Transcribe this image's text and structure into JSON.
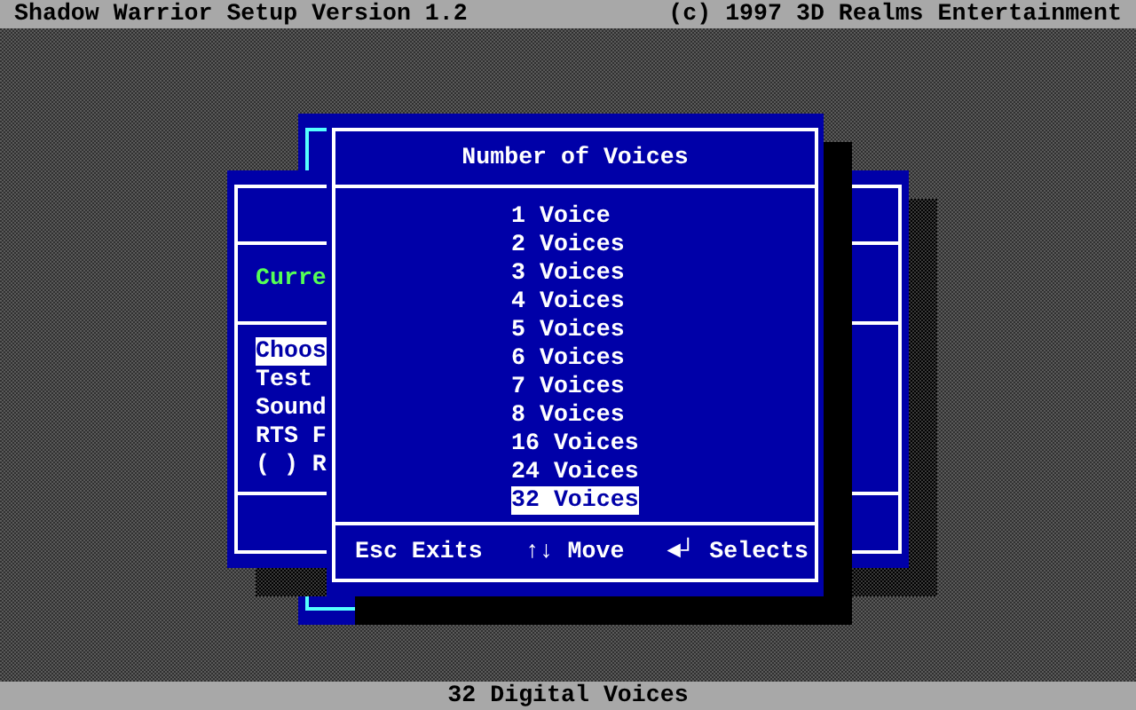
{
  "title_bar": {
    "left": "Shadow Warrior Setup Version 1.2",
    "right": "(c) 1997 3D Realms Entertainment"
  },
  "back_window": {
    "status_text": "Curre",
    "menu_items": [
      {
        "label": "Choos",
        "selected": true
      },
      {
        "label": "Test",
        "selected": false
      },
      {
        "label": "Sound",
        "selected": false
      },
      {
        "label": "RTS F",
        "selected": false
      },
      {
        "label": "( ) R",
        "selected": false
      }
    ]
  },
  "dialog": {
    "title": "Number of Voices",
    "options": [
      {
        "label": "1 Voice",
        "selected": false
      },
      {
        "label": "2 Voices",
        "selected": false
      },
      {
        "label": "3 Voices",
        "selected": false
      },
      {
        "label": "4 Voices",
        "selected": false
      },
      {
        "label": "5 Voices",
        "selected": false
      },
      {
        "label": "6 Voices",
        "selected": false
      },
      {
        "label": "7 Voices",
        "selected": false
      },
      {
        "label": "8 Voices",
        "selected": false
      },
      {
        "label": "16 Voices",
        "selected": false
      },
      {
        "label": "24 Voices",
        "selected": false
      },
      {
        "label": "32 Voices",
        "selected": true
      }
    ],
    "footer_hints": [
      "Esc Exits",
      "↑↓ Move",
      "◄┘ Selects"
    ]
  },
  "status_bar": "32 Digital Voices"
}
